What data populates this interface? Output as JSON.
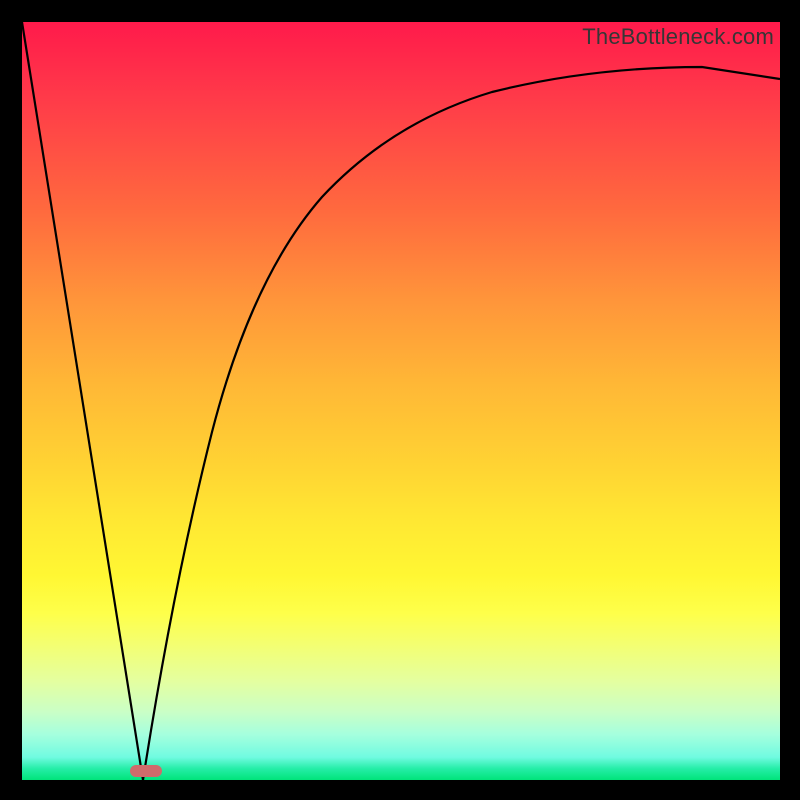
{
  "watermark": "TheBottleneck.com",
  "colors": {
    "frame": "#000000",
    "marker": "#cf6b6b",
    "curve": "#000000"
  },
  "chart_data": {
    "type": "line",
    "title": "",
    "xlabel": "",
    "ylabel": "",
    "xlim": [
      0,
      100
    ],
    "ylim": [
      0,
      100
    ],
    "grid": false,
    "legend": false,
    "series": [
      {
        "name": "left-slope",
        "x": [
          0,
          16
        ],
        "y": [
          100,
          0
        ]
      },
      {
        "name": "right-curve",
        "x": [
          16,
          20,
          25,
          30,
          35,
          40,
          50,
          60,
          70,
          80,
          90,
          100
        ],
        "y": [
          0,
          26,
          46,
          58,
          66,
          72,
          80,
          85,
          88,
          90,
          91.5,
          92.5
        ]
      }
    ],
    "marker": {
      "x": 16.5,
      "y": 0.5
    }
  }
}
